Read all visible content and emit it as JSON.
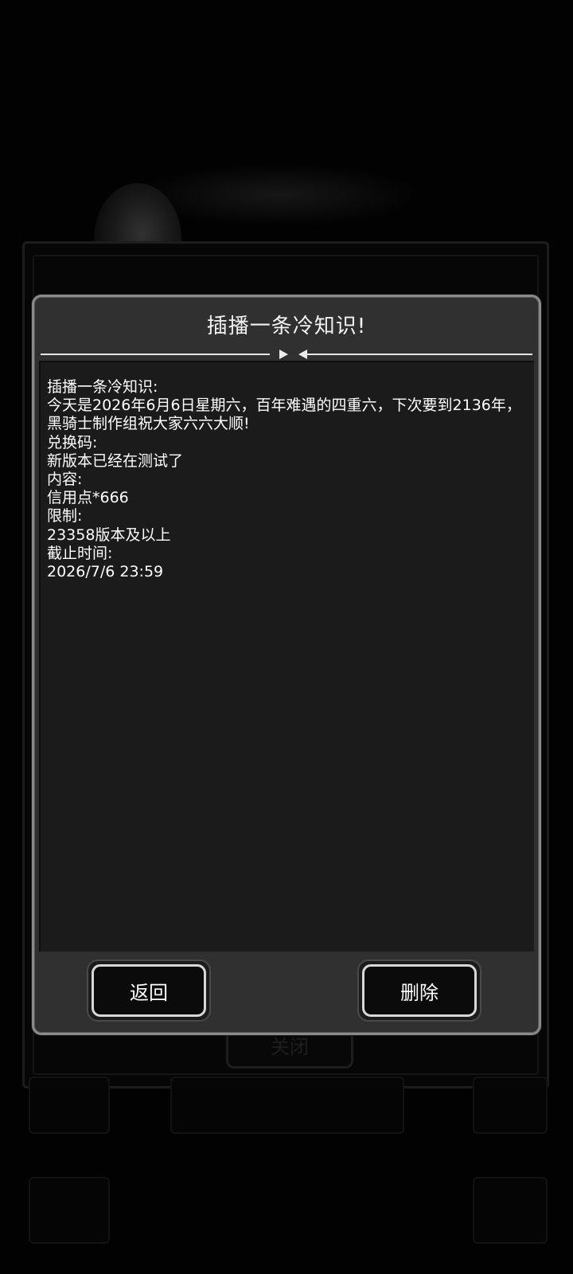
{
  "dialog": {
    "title": "插播一条冷知识!",
    "content_lines": [
      "插播一条冷知识:",
      "今天是2026年6月6日星期六，百年难遇的四重六，下次要到2136年，",
      "黑骑士制作组祝大家六六大顺!",
      "兑换码:",
      "新版本已经在测试了",
      "内容:",
      "信用点*666",
      "限制:",
      "23358版本及以上",
      "截止时间:",
      "2026/7/6 23:59"
    ],
    "buttons": {
      "back_label": "返回",
      "delete_label": "删除"
    }
  },
  "background": {
    "close_label": "关闭"
  },
  "colors": {
    "dialog_bg": "#303030",
    "content_bg": "#1b1b1b",
    "border": "#8a8a8a",
    "text": "#ffffff"
  }
}
